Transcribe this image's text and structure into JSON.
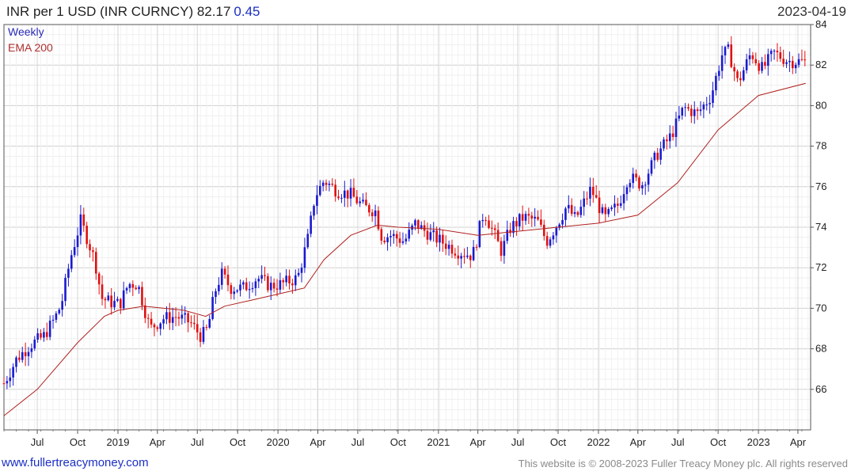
{
  "header": {
    "title": "INR per 1 USD (INR CURNCY) 82.17",
    "change": "0.45",
    "date": "2023-04-19"
  },
  "legend": {
    "frequency": "Weekly",
    "ma_label": "EMA 200"
  },
  "footer": {
    "site": "www.fullertreacymoney.com",
    "copyright": "This website is © 2008-2023 Fuller Treacy Money plc. All rights reserved"
  },
  "colors": {
    "up": "#1a1ad0",
    "down": "#e01010",
    "ema": "#b02020",
    "grid": "#dcdcdc",
    "change": "#1b2fc4"
  },
  "chart_data": {
    "type": "candlestick",
    "frequency": "weekly",
    "ylim": [
      64,
      84
    ],
    "y_ticks": [
      66,
      68,
      70,
      72,
      74,
      76,
      78,
      80,
      82,
      84
    ],
    "x_ticks": [
      {
        "label": "Jul",
        "date": "2018-07-01"
      },
      {
        "label": "Oct",
        "date": "2018-10-01"
      },
      {
        "label": "2019",
        "date": "2019-01-01"
      },
      {
        "label": "Apr",
        "date": "2019-04-01"
      },
      {
        "label": "Jul",
        "date": "2019-07-01"
      },
      {
        "label": "Oct",
        "date": "2019-10-01"
      },
      {
        "label": "2020",
        "date": "2020-01-01"
      },
      {
        "label": "Apr",
        "date": "2020-04-01"
      },
      {
        "label": "Jul",
        "date": "2020-07-01"
      },
      {
        "label": "Oct",
        "date": "2020-10-01"
      },
      {
        "label": "2021",
        "date": "2021-01-01"
      },
      {
        "label": "Apr",
        "date": "2021-04-01"
      },
      {
        "label": "Jul",
        "date": "2021-07-01"
      },
      {
        "label": "Oct",
        "date": "2021-10-01"
      },
      {
        "label": "2022",
        "date": "2022-01-01"
      },
      {
        "label": "Apr",
        "date": "2022-04-01"
      },
      {
        "label": "Jul",
        "date": "2022-07-01"
      },
      {
        "label": "Oct",
        "date": "2022-10-01"
      },
      {
        "label": "2023",
        "date": "2023-01-01"
      },
      {
        "label": "Apr",
        "date": "2023-04-01"
      }
    ],
    "x_range": [
      "2018-04-16",
      "2023-04-30"
    ],
    "price_path": [
      [
        "2018-04-16",
        66.3
      ],
      [
        "2018-05-15",
        67.5
      ],
      [
        "2018-06-15",
        68.2
      ],
      [
        "2018-07-15",
        68.6
      ],
      [
        "2018-08-10",
        69.5
      ],
      [
        "2018-08-25",
        70.2
      ],
      [
        "2018-09-15",
        72.5
      ],
      [
        "2018-10-08",
        74.3
      ],
      [
        "2018-10-22",
        73.5
      ],
      [
        "2018-11-10",
        72.3
      ],
      [
        "2018-11-25",
        70.5
      ],
      [
        "2018-12-15",
        70.3
      ],
      [
        "2019-01-05",
        70.2
      ],
      [
        "2019-01-25",
        71.2
      ],
      [
        "2019-02-15",
        71.2
      ],
      [
        "2019-03-15",
        69.0
      ],
      [
        "2019-04-15",
        69.5
      ],
      [
        "2019-05-15",
        69.6
      ],
      [
        "2019-06-15",
        69.3
      ],
      [
        "2019-07-10",
        68.6
      ],
      [
        "2019-07-25",
        69.0
      ],
      [
        "2019-08-10",
        70.8
      ],
      [
        "2019-08-25",
        71.7
      ],
      [
        "2019-09-15",
        71.0
      ],
      [
        "2019-10-15",
        71.0
      ],
      [
        "2019-11-15",
        71.5
      ],
      [
        "2019-12-15",
        71.1
      ],
      [
        "2020-01-10",
        71.2
      ],
      [
        "2020-02-15",
        71.5
      ],
      [
        "2020-03-10",
        73.5
      ],
      [
        "2020-03-25",
        75.5
      ],
      [
        "2020-04-15",
        76.3
      ],
      [
        "2020-05-15",
        75.8
      ],
      [
        "2020-06-15",
        75.6
      ],
      [
        "2020-07-15",
        75.0
      ],
      [
        "2020-08-10",
        74.8
      ],
      [
        "2020-08-25",
        73.5
      ],
      [
        "2020-09-15",
        73.6
      ],
      [
        "2020-10-15",
        73.3
      ],
      [
        "2020-11-10",
        74.2
      ],
      [
        "2020-11-25",
        73.9
      ],
      [
        "2020-12-15",
        73.6
      ],
      [
        "2021-01-15",
        73.2
      ],
      [
        "2021-02-15",
        72.8
      ],
      [
        "2021-03-20",
        72.6
      ],
      [
        "2021-04-15",
        74.8
      ],
      [
        "2021-05-05",
        73.8
      ],
      [
        "2021-05-25",
        72.8
      ],
      [
        "2021-06-15",
        74.0
      ],
      [
        "2021-07-15",
        74.5
      ],
      [
        "2021-08-15",
        74.3
      ],
      [
        "2021-09-05",
        73.3
      ],
      [
        "2021-09-25",
        74.0
      ],
      [
        "2021-10-20",
        75.0
      ],
      [
        "2021-11-10",
        74.4
      ],
      [
        "2021-12-15",
        75.9
      ],
      [
        "2022-01-15",
        74.4
      ],
      [
        "2022-02-15",
        75.1
      ],
      [
        "2022-03-10",
        76.5
      ],
      [
        "2022-04-10",
        76.1
      ],
      [
        "2022-05-15",
        77.6
      ],
      [
        "2022-06-15",
        78.5
      ],
      [
        "2022-07-15",
        79.9
      ],
      [
        "2022-08-15",
        79.6
      ],
      [
        "2022-09-15",
        80.5
      ],
      [
        "2022-10-10",
        82.5
      ],
      [
        "2022-10-25",
        82.7
      ],
      [
        "2022-11-15",
        81.1
      ],
      [
        "2022-12-15",
        82.6
      ],
      [
        "2023-01-10",
        81.8
      ],
      [
        "2023-02-05",
        82.6
      ],
      [
        "2023-03-10",
        82.2
      ],
      [
        "2023-04-19",
        82.17
      ]
    ],
    "ema_path": [
      [
        "2018-04-16",
        64.7
      ],
      [
        "2018-07-01",
        66.0
      ],
      [
        "2018-10-01",
        68.3
      ],
      [
        "2018-12-01",
        69.6
      ],
      [
        "2019-01-01",
        69.9
      ],
      [
        "2019-03-01",
        70.1
      ],
      [
        "2019-06-01",
        69.9
      ],
      [
        "2019-07-20",
        69.6
      ],
      [
        "2019-09-01",
        70.1
      ],
      [
        "2019-11-01",
        70.4
      ],
      [
        "2020-01-01",
        70.7
      ],
      [
        "2020-03-01",
        71.0
      ],
      [
        "2020-04-15",
        72.4
      ],
      [
        "2020-06-15",
        73.6
      ],
      [
        "2020-08-15",
        74.1
      ],
      [
        "2020-10-01",
        74.0
      ],
      [
        "2021-01-01",
        73.9
      ],
      [
        "2021-04-01",
        73.6
      ],
      [
        "2021-07-01",
        73.8
      ],
      [
        "2021-10-01",
        74.0
      ],
      [
        "2022-01-01",
        74.2
      ],
      [
        "2022-04-01",
        74.6
      ],
      [
        "2022-07-01",
        76.2
      ],
      [
        "2022-10-01",
        78.8
      ],
      [
        "2023-01-01",
        80.5
      ],
      [
        "2023-04-19",
        81.1
      ]
    ]
  }
}
